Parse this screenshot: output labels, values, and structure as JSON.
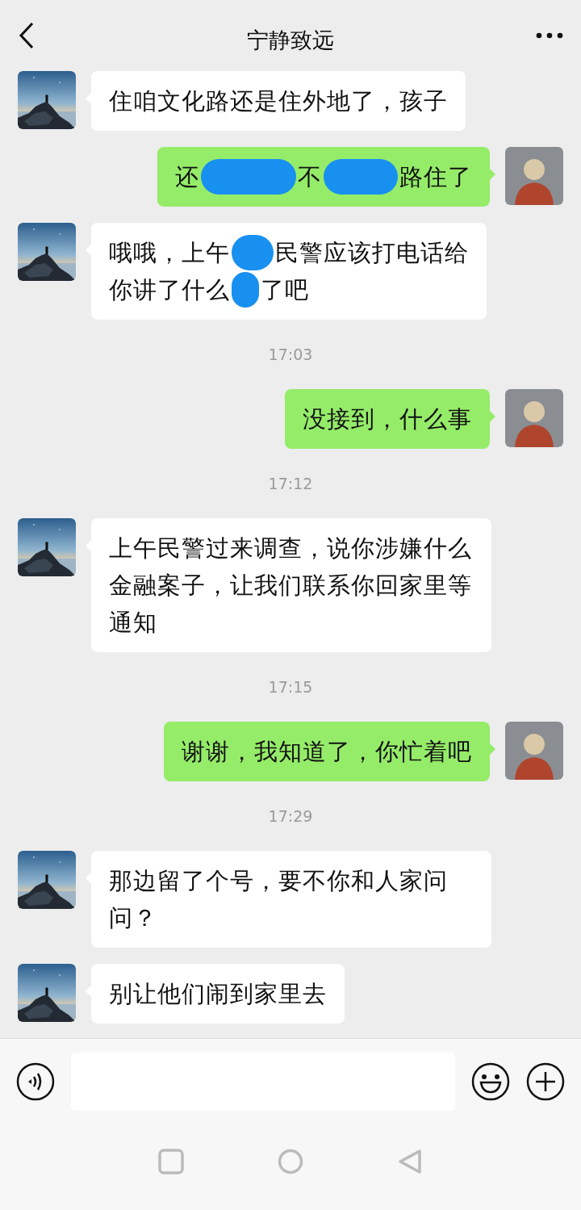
{
  "header": {
    "title": "宁静致远"
  },
  "messages": [
    {
      "kind": "incoming",
      "text": "住咱文化路还是住外地了，孩子"
    },
    {
      "kind": "outgoing",
      "lines": [
        [
          "还",
          "不",
          "路住了"
        ]
      ]
    },
    {
      "kind": "incoming",
      "lines": [
        [
          "哦哦，上午",
          "民警应该打电话给"
        ],
        [
          "你讲了什么",
          "了吧"
        ]
      ]
    },
    {
      "kind": "time",
      "text": "17:03"
    },
    {
      "kind": "outgoing",
      "text": "没接到，什么事"
    },
    {
      "kind": "time",
      "text": "17:12"
    },
    {
      "kind": "incoming",
      "text": "上午民警过来调查，说你涉嫌什么金融案子，让我们联系你回家里等通知"
    },
    {
      "kind": "time",
      "text": "17:15"
    },
    {
      "kind": "outgoing",
      "text": "谢谢，我知道了，你忙着吧"
    },
    {
      "kind": "time",
      "text": "17:29"
    },
    {
      "kind": "incoming",
      "text": "那边留了个号，要不你和人家问问？"
    },
    {
      "kind": "incoming",
      "text": "别让他们闹到家里去"
    }
  ]
}
